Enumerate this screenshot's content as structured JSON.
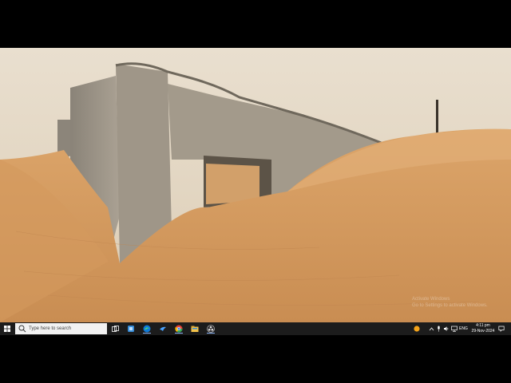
{
  "taskbar": {
    "search_placeholder": "Type here to search",
    "tray_lang": "ENG",
    "clock_time": "4:11 pm",
    "clock_date": "29-Nov-2024"
  },
  "desktop": {
    "watermark_line1": "Activate Windows",
    "watermark_line2": "Go to Settings to activate Windows."
  },
  "icons": {
    "start": "windows-logo-icon",
    "search": "search-icon",
    "task_view": "task-view-icon",
    "pinned": [
      "edge-browser-icon",
      "microsoft-edge-icon",
      "app-blue-bird-icon",
      "chrome-icon",
      "file-explorer-icon",
      "obs-icon"
    ],
    "tray": [
      "weather-icon",
      "chevron-up-icon",
      "microphone-icon",
      "speaker-icon",
      "network-icon",
      "notification-icon"
    ]
  },
  "colors": {
    "taskbar": "#1c1c1c",
    "sky": "#e6dccb",
    "sand": "#d8a064"
  }
}
